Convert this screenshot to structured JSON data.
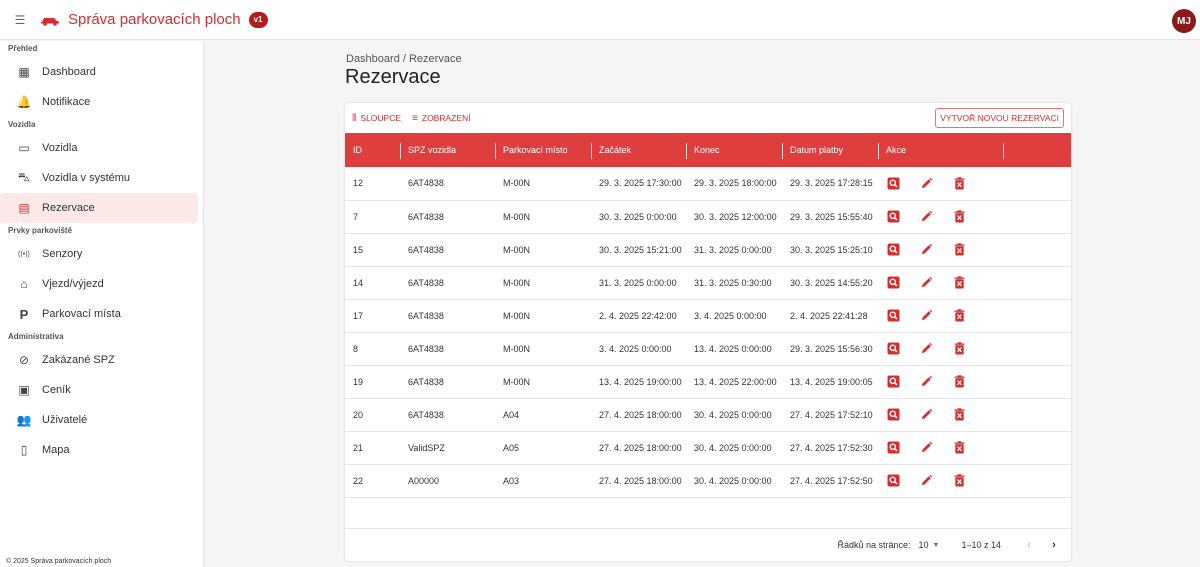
{
  "header": {
    "title": "Správa parkovacích ploch",
    "version": "v1",
    "avatar_initials": "MJ"
  },
  "sidebar": {
    "sections": [
      {
        "title": "Přehled",
        "items": [
          {
            "label": "Dashboard",
            "icon": "dashboard-icon"
          },
          {
            "label": "Notifikace",
            "icon": "bell-icon"
          }
        ]
      },
      {
        "title": "Vozidla",
        "items": [
          {
            "label": "Vozidla",
            "icon": "car-icon"
          },
          {
            "label": "Vozidla v systému",
            "icon": "car-in-icon"
          },
          {
            "label": "Rezervace",
            "icon": "reservation-icon",
            "active": true
          }
        ]
      },
      {
        "title": "Prvky parkoviště",
        "items": [
          {
            "label": "Senzory",
            "icon": "sensor-icon"
          },
          {
            "label": "Vjezd/výjezd",
            "icon": "gate-icon"
          },
          {
            "label": "Parkovací místa",
            "icon": "parking-icon"
          }
        ]
      },
      {
        "title": "Administrativa",
        "items": [
          {
            "label": "Zakázané SPZ",
            "icon": "block-icon"
          },
          {
            "label": "Ceník",
            "icon": "pricing-icon"
          },
          {
            "label": "Uživatelé",
            "icon": "users-icon"
          },
          {
            "label": "Mapa",
            "icon": "map-icon"
          }
        ]
      }
    ],
    "footer": "© 2025 Správa parkovacích ploch"
  },
  "breadcrumb": "Dashboard / Rezervace",
  "page_title": "Rezervace",
  "toolbar": {
    "columns_label": "SLOUPCE",
    "view_label": "ZOBRAZENÍ",
    "create_label": "VYTVOŘ NOVOU REZERVACI"
  },
  "table": {
    "headers": [
      "ID",
      "SPZ vozidla",
      "Parkovací místo",
      "Začátek",
      "Konec",
      "Datum platby",
      "Akce"
    ],
    "rows": [
      [
        "12",
        "6AT4838",
        "M-00N",
        "29. 3. 2025 17:30:00",
        "29. 3. 2025 18:00:00",
        "29. 3. 2025 17:28:15"
      ],
      [
        "7",
        "6AT4838",
        "M-00N",
        "30. 3. 2025 0:00:00",
        "30. 3. 2025 12:00:00",
        "29. 3. 2025 15:55:40"
      ],
      [
        "15",
        "6AT4838",
        "M-00N",
        "30. 3. 2025 15:21:00",
        "31. 3. 2025 0:00:00",
        "30. 3. 2025 15:25:10"
      ],
      [
        "14",
        "6AT4838",
        "M-00N",
        "31. 3. 2025 0:00:00",
        "31. 3. 2025 0:30:00",
        "30. 3. 2025 14:55:20"
      ],
      [
        "17",
        "6AT4838",
        "M-00N",
        "2. 4. 2025 22:42:00",
        "3. 4. 2025 0:00:00",
        "2. 4. 2025 22:41:28"
      ],
      [
        "8",
        "6AT4838",
        "M-00N",
        "3. 4. 2025 0:00:00",
        "13. 4. 2025 0:00:00",
        "29. 3. 2025 15:56:30"
      ],
      [
        "19",
        "6AT4838",
        "M-00N",
        "13. 4. 2025 19:00:00",
        "13. 4. 2025 22:00:00",
        "13. 4. 2025 19:00:05"
      ],
      [
        "20",
        "6AT4838",
        "A04",
        "27. 4. 2025 18:00:00",
        "30. 4. 2025 0:00:00",
        "27. 4. 2025 17:52:10"
      ],
      [
        "21",
        "ValidSPZ",
        "A05",
        "27. 4. 2025 18:00:00",
        "30. 4. 2025 0:00:00",
        "27. 4. 2025 17:52:30"
      ],
      [
        "22",
        "A00000",
        "A03",
        "27. 4. 2025 18:00:00",
        "30. 4. 2025 0:00:00",
        "27. 4. 2025 17:52:50"
      ]
    ]
  },
  "pagination": {
    "rows_label": "Řádků na stránce:",
    "rows_value": "10",
    "range": "1–10 z 14"
  },
  "colors": {
    "accent": "#d32f2f",
    "header_bg": "#df3e3e",
    "active_bg": "#fde8e8"
  }
}
